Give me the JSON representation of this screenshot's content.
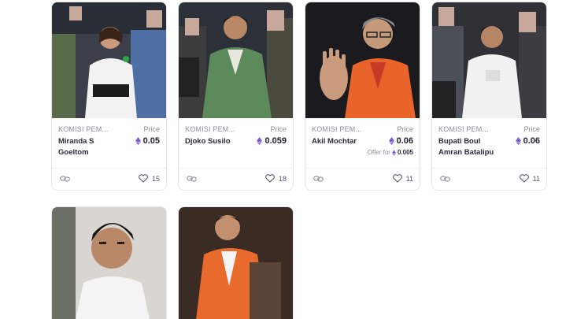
{
  "cards": [
    {
      "collection": "KOMISI PEM...",
      "price_label": "Price",
      "name": "Miranda S Goeltom",
      "price": "0.05",
      "likes": "15",
      "offer_label": "",
      "offer_value": ""
    },
    {
      "collection": "KOMISI PEM...",
      "price_label": "Price",
      "name": "Djoko Susilo",
      "price": "0.059",
      "likes": "18",
      "offer_label": "",
      "offer_value": ""
    },
    {
      "collection": "KOMISI PEM...",
      "price_label": "Price",
      "name": "Akil Mochtar",
      "price": "0.06",
      "likes": "11",
      "offer_label": "Offer for",
      "offer_value": "0.005"
    },
    {
      "collection": "KOMISI PEM...",
      "price_label": "Price",
      "name": "Bupati Boul Amran Batalipu",
      "price": "0.06",
      "likes": "11",
      "offer_label": "",
      "offer_value": ""
    }
  ],
  "icons": {
    "currency": "ethereum-icon",
    "link": "link-icon",
    "favorite": "heart-icon"
  },
  "colors": {
    "eth": "#7b5cd6",
    "muted": "#8e8e9a",
    "text": "#2b2b36",
    "border": "#e6e6e9"
  }
}
